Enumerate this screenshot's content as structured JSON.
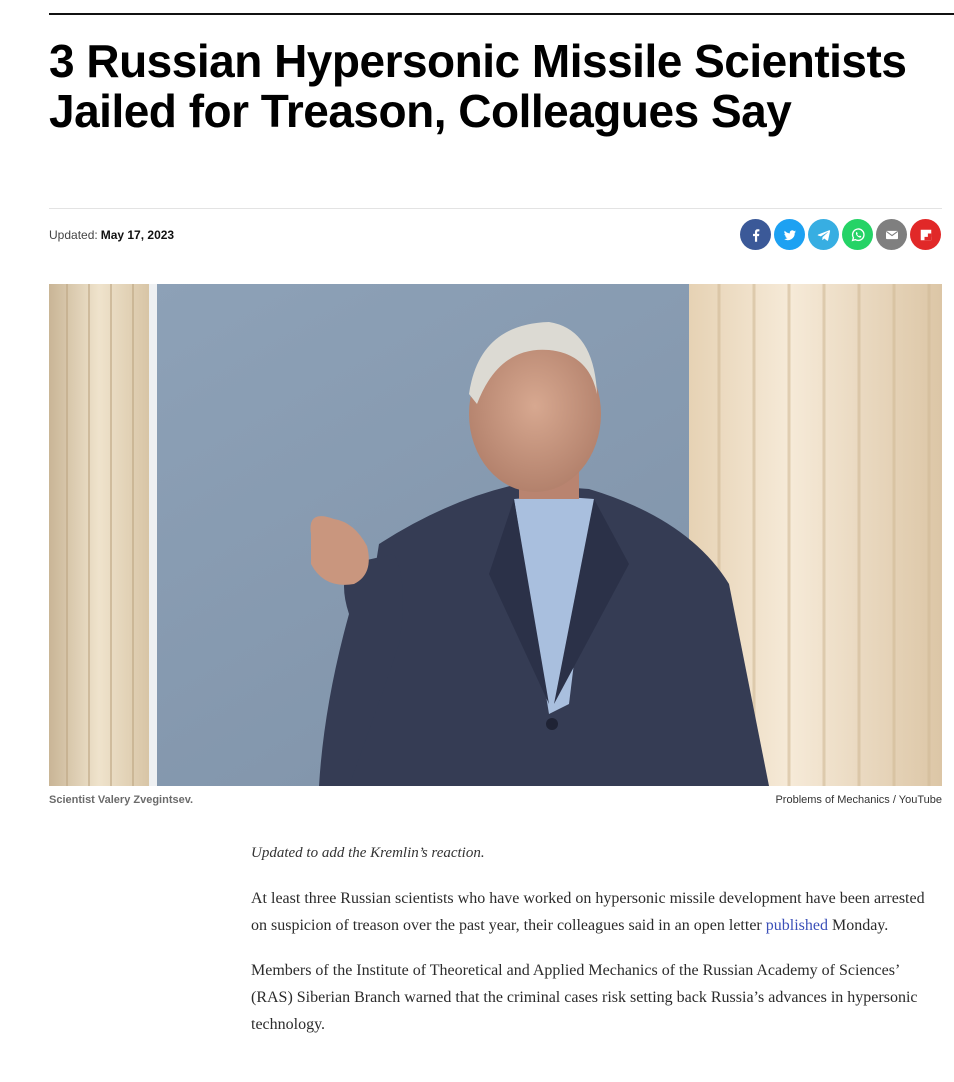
{
  "headline": "3 Russian Hypersonic Missile Scientists Jailed for Treason, Colleagues Say",
  "meta": {
    "updated_label": "Updated:",
    "updated_date": "May 17, 2023"
  },
  "share": [
    {
      "name": "facebook-share-button",
      "icon": "facebook-icon",
      "color": "#3b5998"
    },
    {
      "name": "twitter-share-button",
      "icon": "twitter-icon",
      "color": "#1da1f2"
    },
    {
      "name": "telegram-share-button",
      "icon": "telegram-icon",
      "color": "#37aee2"
    },
    {
      "name": "whatsapp-share-button",
      "icon": "whatsapp-icon",
      "color": "#25d366"
    },
    {
      "name": "email-share-button",
      "icon": "mail-icon",
      "color": "#7f7f7f"
    },
    {
      "name": "flipboard-share-button",
      "icon": "flipboard-icon",
      "color": "#e12828"
    }
  ],
  "photo": {
    "caption": "Scientist Valery Zvegintsev.",
    "credit": "Problems of Mechanics / YouTube"
  },
  "article": {
    "note": "Updated to add the Kremlin’s reaction.",
    "p1_before": "At least three Russian scientists who have worked on hypersonic missile development have been arrested on suspicion of treason over the past year, their colleagues said in an open letter ",
    "p1_link": "published",
    "p1_after": " Monday.",
    "p2": "Members of the Institute of Theoretical and Applied Mechanics of the Russian Academy of Sciences’ (RAS) Siberian Branch warned that the criminal cases risk setting back Russia’s advances in hypersonic technology."
  }
}
